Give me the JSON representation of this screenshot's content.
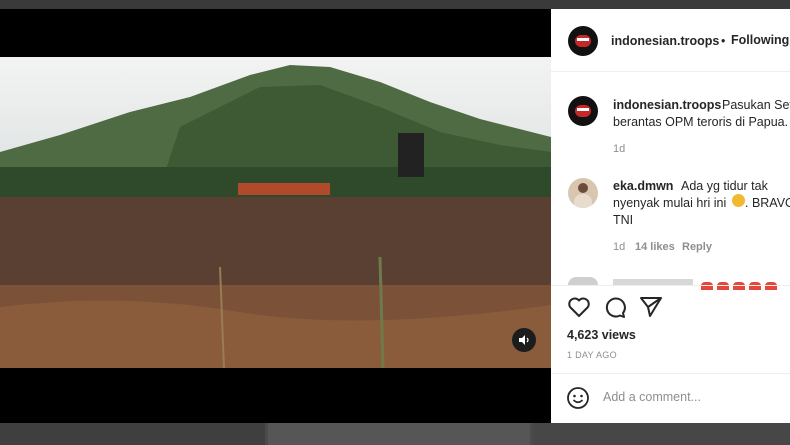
{
  "post": {
    "username": "indonesian.troops",
    "follow_status": "Following",
    "caption_line1": "Pasukan Set",
    "caption_line2": "berantas OPM teroris di Papua.",
    "caption_time": "1d",
    "views": "4,623 views",
    "posted": "1 DAY AGO",
    "add_comment_placeholder": "Add a comment..."
  },
  "comment": {
    "username": "eka.dmwn",
    "text_line1": "Ada yg tidur tak",
    "text_line2": "nyenyak mulai hri ini",
    "text_tail": ". BRAVO",
    "text_line3": "TNI",
    "time": "1d",
    "likes": "14 likes",
    "reply": "Reply"
  },
  "icons": [
    "heart-icon",
    "comment-icon",
    "share-icon",
    "emoji-icon",
    "sound-icon"
  ],
  "colors": {
    "accent_red": "#c62828",
    "muted": "#8e8e8e"
  }
}
